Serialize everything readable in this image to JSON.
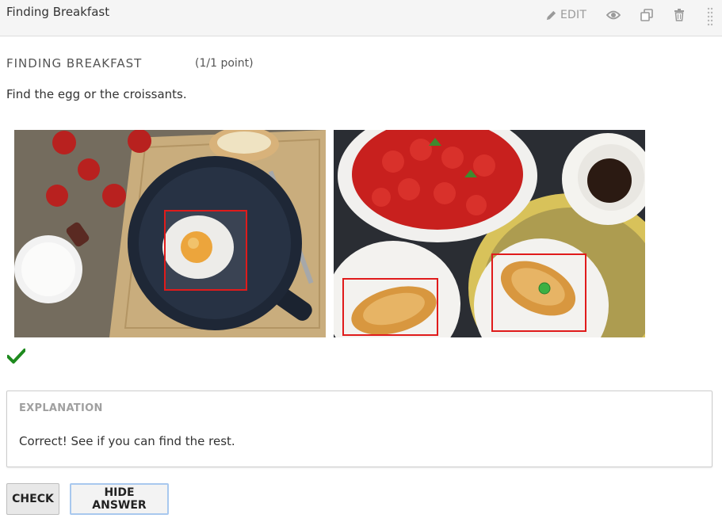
{
  "header": {
    "title": "Finding Breakfast",
    "edit_label": "EDIT",
    "tools": [
      "pencil-icon",
      "eye-icon",
      "duplicate-icon",
      "trash-icon",
      "drag-handle-icon"
    ]
  },
  "problem": {
    "title": "FINDING BREAKFAST",
    "points": "(1/1 point)",
    "prompt": "Find the egg or the croissants."
  },
  "images": [
    {
      "name": "breakfast-pan-image",
      "subject": "fried egg in pan with tomatoes, milk and toast",
      "target_box": "egg"
    },
    {
      "name": "strawberries-croissants-image",
      "subject": "strawberries, coffee and croissants",
      "target_box": "croissants"
    }
  ],
  "result": {
    "status": "correct",
    "icon": "checkmark-icon",
    "color": "#1e8a1e"
  },
  "explanation": {
    "label": "EXPLANATION",
    "text": "Correct! See if you can find the rest."
  },
  "buttons": {
    "check_label": "CHECK",
    "hide_answer_label": "HIDE ANSWER"
  },
  "colors": {
    "answer_box": "#e01b1b",
    "click_marker": "#3cb043",
    "focus_border": "#a8c8ee"
  }
}
